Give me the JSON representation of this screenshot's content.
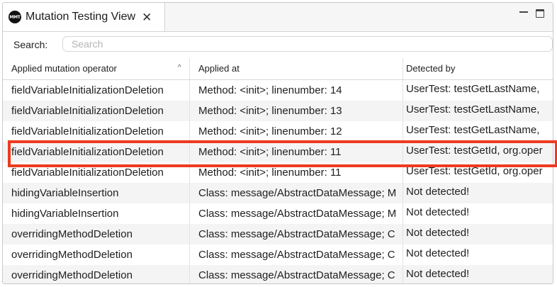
{
  "view": {
    "tab_logo": "MMT",
    "tab_title": "Mutation Testing View",
    "tab_close": "✕"
  },
  "search": {
    "label": "Search:",
    "placeholder": "Search",
    "value": ""
  },
  "table": {
    "columns": [
      "Applied mutation operator",
      "Applied at",
      "Detected by"
    ],
    "sort_indicator": "^",
    "rows": [
      {
        "operator": "fieldVariableInitializationDeletion",
        "applied_at": "Method: <init>; linenumber: 14",
        "detected_by": "UserTest: testGetLastName,"
      },
      {
        "operator": "fieldVariableInitializationDeletion",
        "applied_at": "Method: <init>; linenumber: 13",
        "detected_by": "UserTest: testGetLastName,"
      },
      {
        "operator": "fieldVariableInitializationDeletion",
        "applied_at": "Method: <init>; linenumber: 12",
        "detected_by": "UserTest: testGetLastName,"
      },
      {
        "operator": "fieldVariableInitializationDeletion",
        "applied_at": "Method: <init>; linenumber: 11",
        "detected_by": "UserTest: testGetId, org.oper"
      },
      {
        "operator": "fieldVariableInitializationDeletion",
        "applied_at": "Method: <init>; linenumber: 11",
        "detected_by": "UserTest: testGetId, org.oper"
      },
      {
        "operator": "hidingVariableInsertion",
        "applied_at": "Class: message/AbstractDataMessage; M",
        "detected_by": "Not detected!"
      },
      {
        "operator": "hidingVariableInsertion",
        "applied_at": "Class: message/AbstractDataMessage; M",
        "detected_by": "Not detected!"
      },
      {
        "operator": "overridingMethodDeletion",
        "applied_at": "Class: message/AbstractDataMessage; C",
        "detected_by": "Not detected!"
      },
      {
        "operator": "overridingMethodDeletion",
        "applied_at": "Class: message/AbstractDataMessage; C",
        "detected_by": "Not detected!"
      },
      {
        "operator": "overridingMethodDeletion",
        "applied_at": "Class: message/AbstractDataMessage; C",
        "detected_by": "Not detected!"
      }
    ]
  },
  "colors": {
    "highlight": "#ee3a20",
    "alt_row": "#f4f4f4"
  }
}
